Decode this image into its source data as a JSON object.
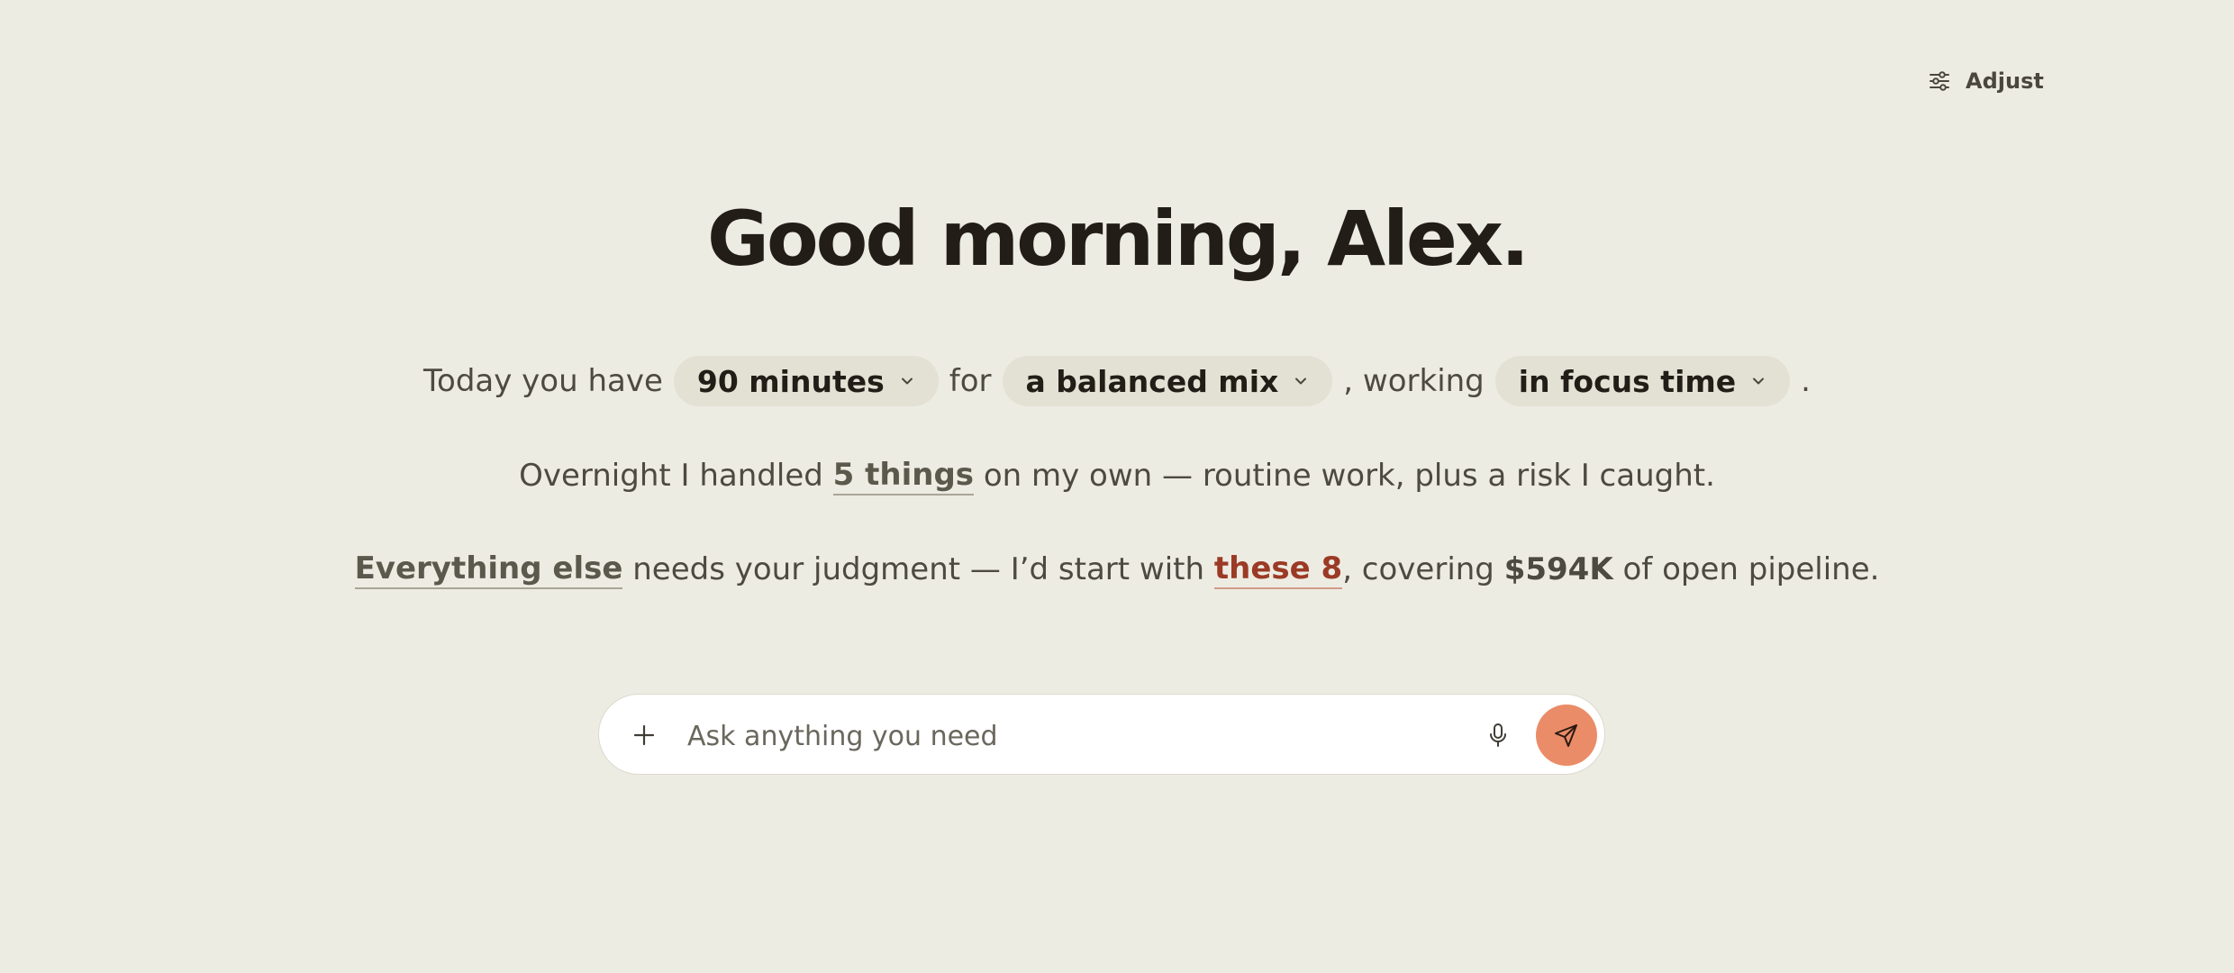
{
  "header": {
    "adjust_label": "Adjust",
    "adjust_icon": "sliders-icon"
  },
  "greeting": "Good morning, Alex.",
  "summary": {
    "line1": {
      "prefix": "Today you have",
      "time": "90 minutes",
      "for_word": "for",
      "mix": "a balanced mix",
      "working_word": ", working",
      "mode": "in focus time",
      "end": "."
    },
    "line2": {
      "prefix": "Overnight I handled ",
      "link": "5 things",
      "suffix": " on my own — routine work, plus a risk I caught."
    },
    "line3": {
      "link": "Everything else",
      "middle": " needs your judgment — I’d start with ",
      "link_red": "these 8",
      "covering": ", covering ",
      "amount": "$594K",
      "suffix": " of open pipeline."
    }
  },
  "composer": {
    "placeholder": "Ask anything you need",
    "plus_icon": "plus-icon",
    "mic_icon": "microphone-icon",
    "send_icon": "send-icon"
  },
  "colors": {
    "background": "#edece3",
    "heading": "#221d17",
    "body_text": "#4d4a41",
    "pill_bg": "#e3e1d4",
    "accent_red": "#9b3a25",
    "send_button": "#ea8c68",
    "composer_bg": "#ffffff"
  }
}
